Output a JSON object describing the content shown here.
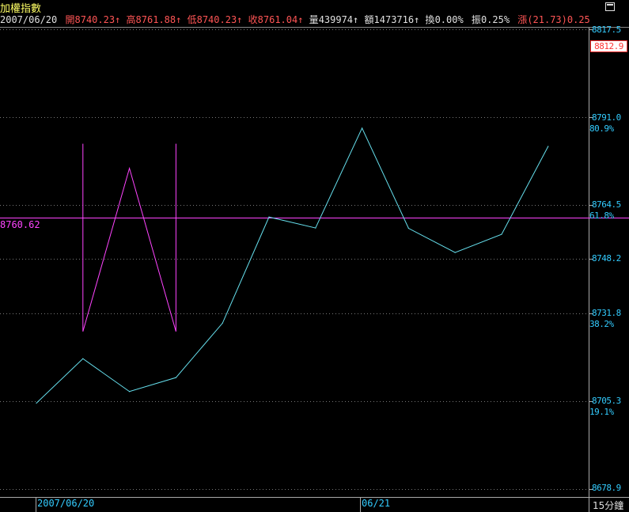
{
  "header": {
    "title": "加權指數",
    "date": "2007/06/20",
    "open_label": "開",
    "open": "8740.23↑",
    "high_label": "高",
    "high": "8761.88↑",
    "low_label": "低",
    "low": "8740.23↑",
    "close_label": "收",
    "close": "8761.04↑",
    "volume_label": "量",
    "volume": "439974↑",
    "amount_label": "額",
    "amount": "1473716↑",
    "turnover_label": "換",
    "turnover": "0.00%",
    "amplitude_label": "振",
    "amplitude": "0.25%",
    "change_label": "漲",
    "change": "(21.73)0.25%"
  },
  "colors": {
    "background": "#000000",
    "price_line": "#66e0ee",
    "marker": "#ff44ff",
    "axis_text": "#33ccff",
    "up": "#ff5555"
  },
  "chart_data": {
    "type": "line",
    "y_axis_ticks": [
      "8817.5",
      "8791.0",
      "8764.5",
      "8748.2",
      "8731.8",
      "8705.3",
      "8678.9"
    ],
    "fib_levels": [
      "80.9%",
      "61.8%",
      "38.2%",
      "19.1%"
    ],
    "current_value_label": "8812.9",
    "horizontal_line_label": "8760.62",
    "horizontal_line_value": 8760.62,
    "x_labels": [
      "2007/06/20",
      "06/21"
    ],
    "interval_label": "15分鐘",
    "ylim": [
      8678.9,
      8817.5
    ],
    "series": [
      {
        "values": [
          8704.8,
          8718.2,
          8708.3,
          8712.5,
          8728.9,
          8760.9,
          8757.6,
          8787.7,
          8757.5,
          8750.2,
          8755.7,
          8782.2
        ]
      }
    ],
    "w_pattern": [
      {
        "index": 1,
        "value": 8726.4
      },
      {
        "index": 2,
        "value": 8775.6
      },
      {
        "index": 3,
        "value": 8726.4
      }
    ],
    "w_pattern_bars": [
      {
        "index": 1,
        "top": 8783.0,
        "bottom": 8726.4
      },
      {
        "index": 3,
        "top": 8783.0,
        "bottom": 8726.4
      }
    ]
  }
}
